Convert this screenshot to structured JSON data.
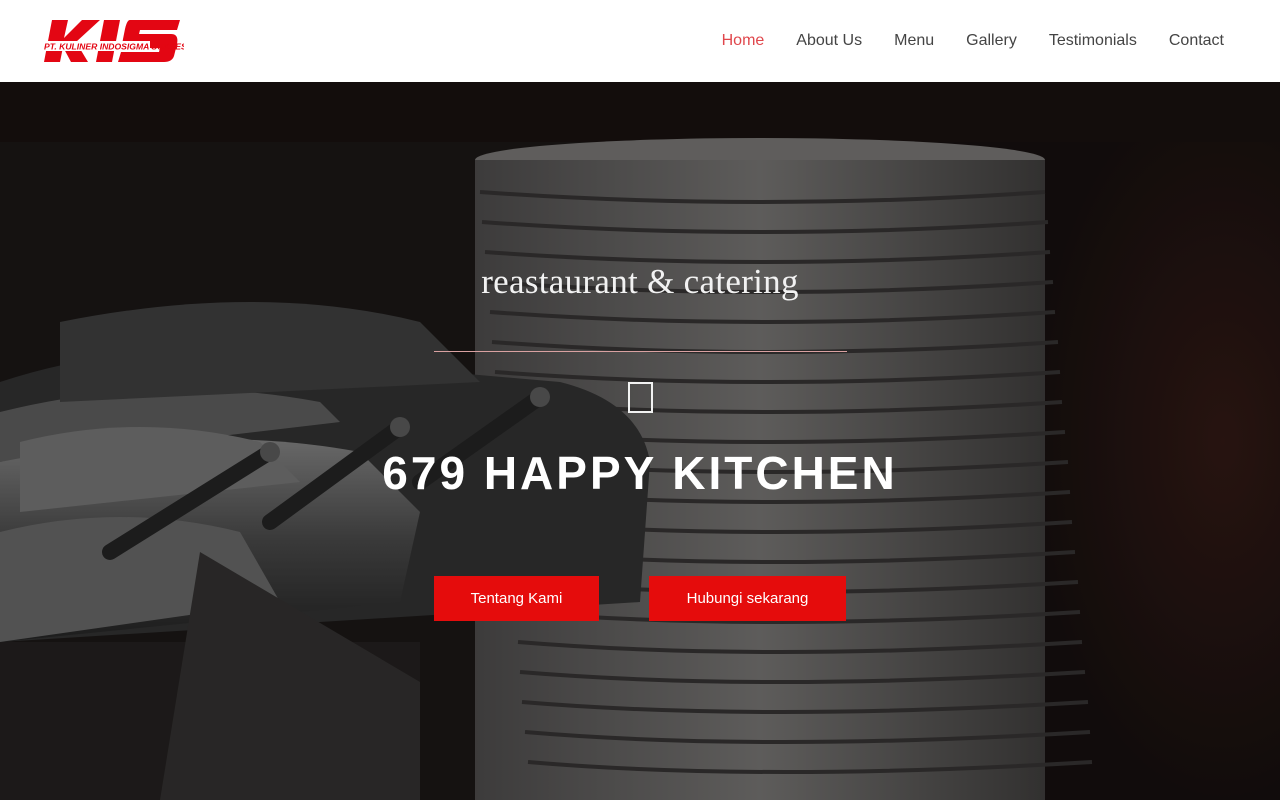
{
  "brand": {
    "logo_text": "KIS",
    "logo_subtext": "PT. KULINER INDOSIGMA SUKSES",
    "logo_color": "#e30613"
  },
  "nav": {
    "items": [
      {
        "label": "Home",
        "active": true
      },
      {
        "label": "About Us",
        "active": false
      },
      {
        "label": "Menu",
        "active": false
      },
      {
        "label": "Gallery",
        "active": false
      },
      {
        "label": "Testimonials",
        "active": false
      },
      {
        "label": "Contact",
        "active": false
      }
    ],
    "active_color": "#e0474c"
  },
  "hero": {
    "tagline": "reastaurant & catering",
    "icon": "square-outline-icon",
    "title": "679 HAPPY KITCHEN",
    "buttons": {
      "about_label": "Tentang Kami",
      "contact_label": "Hubungi sekarang"
    },
    "button_color": "#e50c0c",
    "background_description_icon": "chafing-dishes-and-plates-photo"
  }
}
